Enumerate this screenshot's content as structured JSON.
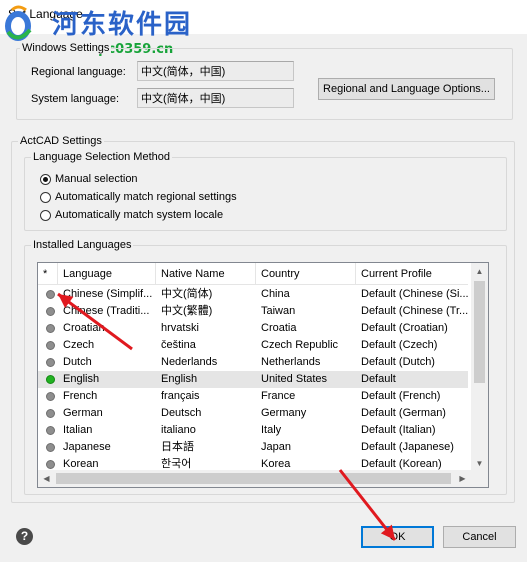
{
  "window": {
    "title": "Set Language"
  },
  "watermark": {
    "site": "河东软件园",
    "url": "www.pc0359.cn"
  },
  "windows_settings": {
    "label": "Windows Settings",
    "regional_label": "Regional language:",
    "regional_value": "中文(简体，中国)",
    "system_label": "System language:",
    "system_value": "中文(简体，中国)",
    "options_button": "Regional and Language Options..."
  },
  "actcad_settings": {
    "label": "ActCAD Settings",
    "method_label": "Language Selection Method",
    "options": [
      {
        "label": "Manual selection",
        "checked": true
      },
      {
        "label": "Automatically match regional settings",
        "checked": false
      },
      {
        "label": "Automatically match system locale",
        "checked": false
      }
    ]
  },
  "installed": {
    "label": "Installed Languages",
    "columns": [
      "*",
      "Language",
      "Native Name",
      "Country",
      "Current Profile"
    ],
    "rows": [
      {
        "language": "Chinese (Simplif...",
        "native": "中文(简体)",
        "country": "China",
        "profile": "Default (Chinese (Si...",
        "active": false,
        "selected": false
      },
      {
        "language": "Chinese (Traditi...",
        "native": "中文(繁體)",
        "country": "Taiwan",
        "profile": "Default (Chinese (Tr...",
        "active": false,
        "selected": false
      },
      {
        "language": "Croatian",
        "native": "hrvatski",
        "country": "Croatia",
        "profile": "Default (Croatian)",
        "active": false,
        "selected": false
      },
      {
        "language": "Czech",
        "native": "čeština",
        "country": "Czech Republic",
        "profile": "Default (Czech)",
        "active": false,
        "selected": false
      },
      {
        "language": "Dutch",
        "native": "Nederlands",
        "country": "Netherlands",
        "profile": "Default (Dutch)",
        "active": false,
        "selected": false
      },
      {
        "language": "English",
        "native": "English",
        "country": "United States",
        "profile": "Default",
        "active": true,
        "selected": true
      },
      {
        "language": "French",
        "native": "français",
        "country": "France",
        "profile": "Default (French)",
        "active": false,
        "selected": false
      },
      {
        "language": "German",
        "native": "Deutsch",
        "country": "Germany",
        "profile": "Default (German)",
        "active": false,
        "selected": false
      },
      {
        "language": "Italian",
        "native": "italiano",
        "country": "Italy",
        "profile": "Default (Italian)",
        "active": false,
        "selected": false
      },
      {
        "language": "Japanese",
        "native": "日本語",
        "country": "Japan",
        "profile": "Default (Japanese)",
        "active": false,
        "selected": false
      },
      {
        "language": "Korean",
        "native": "한국어",
        "country": "Korea",
        "profile": "Default (Korean)",
        "active": false,
        "selected": false
      }
    ]
  },
  "buttons": {
    "ok": "OK",
    "cancel": "Cancel"
  },
  "colors": {
    "annotation_arrow": "#e0191f",
    "default_button_border": "#0078d7",
    "active_dot": "#22b222"
  }
}
